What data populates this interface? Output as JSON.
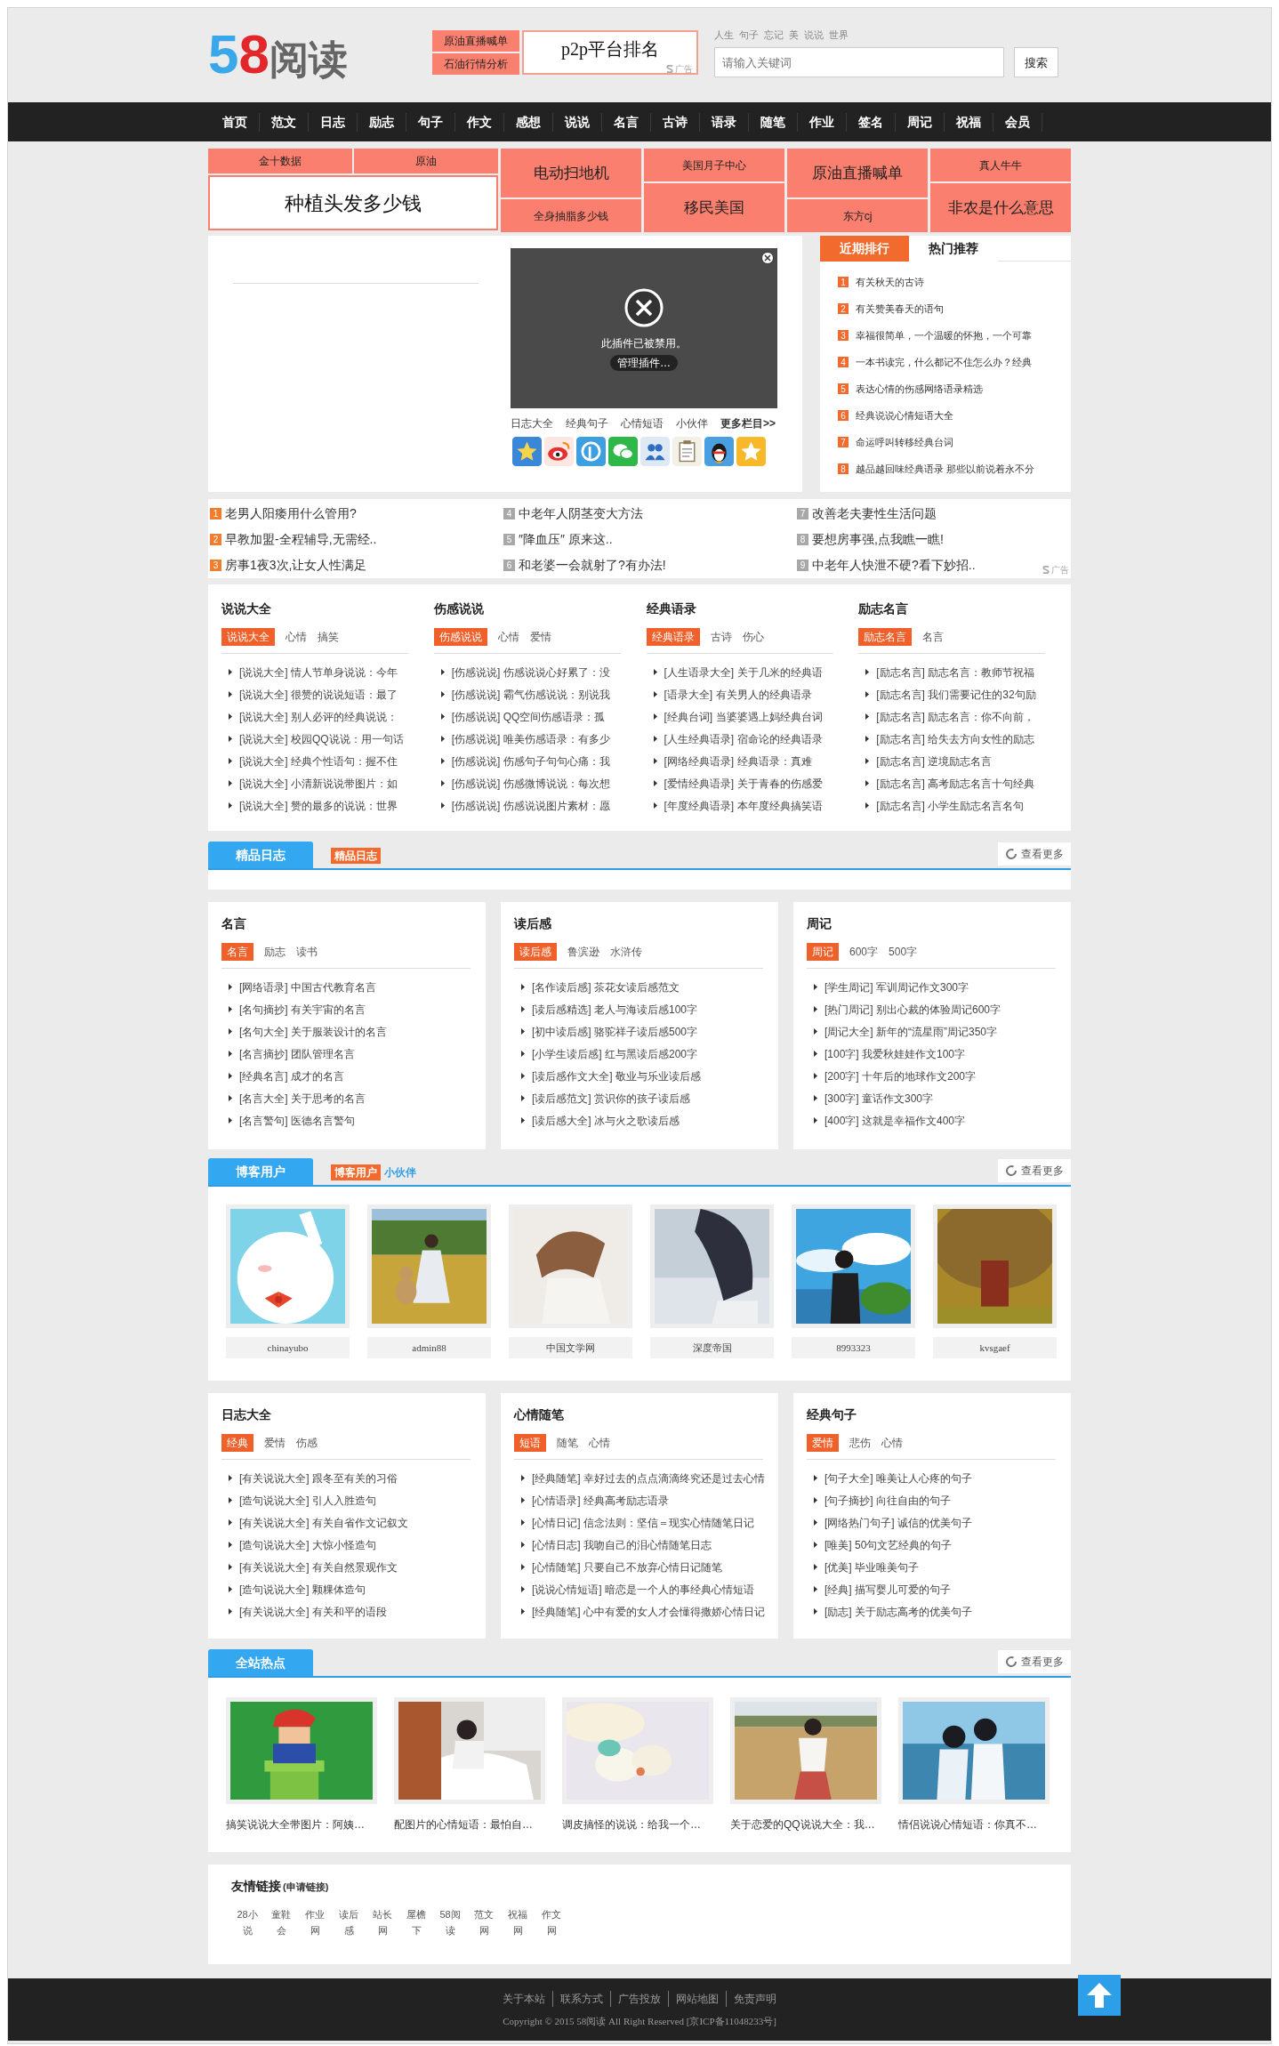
{
  "header": {
    "logo_digits": "58",
    "logo_name": "阅读",
    "ad_links": [
      "原油直播喊单",
      "石油行情分析"
    ],
    "ad_main": "p2p平台排名",
    "ad_mark": "广告",
    "hot_words": [
      "人生",
      "句子",
      "忘记",
      "美",
      "说说",
      "世界"
    ],
    "search": {
      "placeholder": "请输入关键词",
      "button": "搜索"
    }
  },
  "nav": [
    "首页",
    "范文",
    "日志",
    "励志",
    "句子",
    "作文",
    "感想",
    "说说",
    "名言",
    "古诗",
    "语录",
    "随笔",
    "作业",
    "签名",
    "周记",
    "祝福",
    "会员"
  ],
  "ad_grid": {
    "top": [
      "金十数据",
      "原油"
    ],
    "main": "种植头发多少钱",
    "columns": [
      {
        "cells": [
          {
            "text": "电动扫地机",
            "kind": "large"
          },
          {
            "text": "全身抽脂多少钱",
            "kind": "small"
          }
        ]
      },
      {
        "cells": [
          {
            "text": "美国月子中心",
            "kind": "small"
          },
          {
            "text": "移民美国",
            "kind": "large"
          }
        ]
      },
      {
        "cells": [
          {
            "text": "原油直播喊单",
            "kind": "large"
          },
          {
            "text": "东方cj",
            "kind": "small"
          }
        ]
      },
      {
        "cells": [
          {
            "text": "真人牛牛",
            "kind": "small"
          },
          {
            "text": "非农是什么意思",
            "kind": "large"
          }
        ]
      }
    ]
  },
  "plugin": {
    "message": "此插件已被禁用。",
    "button": "管理插件…"
  },
  "quick_links": [
    "日志大全",
    "经典句子",
    "心情短语",
    "小伙伴"
  ],
  "more_columns": "更多栏目>>",
  "ranking": {
    "tabs": [
      {
        "label": "近期排行",
        "selected": true
      },
      {
        "label": "热门推荐",
        "selected": false
      }
    ],
    "items": [
      {
        "num": "1",
        "text": "有关秋天的古诗"
      },
      {
        "num": "2",
        "text": "有关赞美春天的语句"
      },
      {
        "num": "3",
        "text": "幸福很简单，一个温暖的怀抱，一个可靠"
      },
      {
        "num": "4",
        "text": "一本书读完，什么都记不住怎么办？经典"
      },
      {
        "num": "5",
        "text": "表达心情的伤感网络语录精选"
      },
      {
        "num": "6",
        "text": "经典说说心情短语大全"
      },
      {
        "num": "7",
        "text": "命运呼叫转移经典台词"
      },
      {
        "num": "8",
        "text": "越品越回味经典语录 那些以前说着永不分"
      }
    ]
  },
  "text_ads": {
    "mark": "广告",
    "items": [
      {
        "num": "1",
        "text": "老男人阳痿用什么管用?",
        "hot": true
      },
      {
        "num": "2",
        "text": "早教加盟-全程辅导,无需经..",
        "hot": true
      },
      {
        "num": "3",
        "text": "房事1夜3次,让女人性满足",
        "hot": true
      },
      {
        "num": "4",
        "text": "中老年人阴茎变大方法",
        "hot": false
      },
      {
        "num": "5",
        "text": "″降血压″ 原来这..",
        "hot": false
      },
      {
        "num": "6",
        "text": "和老婆一会就射了?有办法!",
        "hot": false
      },
      {
        "num": "7",
        "text": "改善老夫妻性生活问题",
        "hot": false
      },
      {
        "num": "8",
        "text": "要想房事强,点我瞧一瞧!",
        "hot": false
      },
      {
        "num": "9",
        "text": "中老年人快泄不硬?看下妙招..",
        "hot": false
      }
    ]
  },
  "categories_1": [
    {
      "title": "说说大全",
      "tags": [
        {
          "label": "说说大全",
          "selected": true
        },
        {
          "label": "心情",
          "selected": false
        },
        {
          "label": "搞笑",
          "selected": false
        }
      ],
      "items": [
        "[说说大全] 情人节单身说说：今年",
        "[说说大全] 很赞的说说短语：最了",
        "[说说大全] 别人必评的经典说说：",
        "[说说大全] 校园QQ说说：用一句话",
        "[说说大全] 经典个性语句：握不住",
        "[说说大全] 小清新说说带图片：如",
        "[说说大全] 赞的最多的说说：世界"
      ]
    },
    {
      "title": "伤感说说",
      "tags": [
        {
          "label": "伤感说说",
          "selected": true
        },
        {
          "label": "心情",
          "selected": false
        },
        {
          "label": "爱情",
          "selected": false
        }
      ],
      "items": [
        "[伤感说说] 伤感说说心好累了：没",
        "[伤感说说] 霸气伤感说说：别说我",
        "[伤感说说] QQ空间伤感语录：孤",
        "[伤感说说] 唯美伤感语录：有多少",
        "[伤感说说] 伤感句子句句心痛：我",
        "[伤感说说] 伤感微博说说：每次想",
        "[伤感说说] 伤感说说图片素材：愿"
      ]
    },
    {
      "title": "经典语录",
      "tags": [
        {
          "label": "经典语录",
          "selected": true
        },
        {
          "label": "古诗",
          "selected": false
        },
        {
          "label": "伤心",
          "selected": false
        }
      ],
      "items": [
        "[人生语录大全] 关于几米的经典语",
        "[语录大全] 有关男人的经典语录",
        "[经典台词] 当婆婆遇上妈经典台词",
        "[人生经典语录] 宿命论的经典语录",
        "[网络经典语录] 经典语录：真难",
        "[爱情经典语录] 关于青春的伤感爱",
        "[年度经典语录] 本年度经典搞笑语"
      ]
    },
    {
      "title": "励志名言",
      "tags": [
        {
          "label": "励志名言",
          "selected": true
        },
        {
          "label": "名言",
          "selected": false
        }
      ],
      "items": [
        "[励志名言] 励志名言：教师节祝福",
        "[励志名言] 我们需要记住的32句励",
        "[励志名言] 励志名言：你不向前，",
        "[励志名言] 给失去方向女性的励志",
        "[励志名言] 逆境励志名言",
        "[励志名言] 高考励志名言十句经典",
        "[励志名言] 小学生励志名言名句"
      ]
    }
  ],
  "section_diary": {
    "tab": "精品日志",
    "badge": "精品日志",
    "more": "查看更多"
  },
  "categories_2": [
    {
      "title": "名言",
      "tags": [
        {
          "label": "名言",
          "selected": true
        },
        {
          "label": "励志",
          "selected": false
        },
        {
          "label": "读书",
          "selected": false
        }
      ],
      "items": [
        "[网络语录] 中国古代教育名言",
        "[名句摘抄] 有关宇宙的名言",
        "[名句大全] 关于服装设计的名言",
        "[名言摘抄] 团队管理名言",
        "[经典名言] 成才的名言",
        "[名言大全] 关于思考的名言",
        "[名言警句] 医德名言警句"
      ]
    },
    {
      "title": "读后感",
      "tags": [
        {
          "label": "读后感",
          "selected": true
        },
        {
          "label": "鲁滨逊",
          "selected": false
        },
        {
          "label": "水浒传",
          "selected": false
        }
      ],
      "items": [
        "[名作读后感] 茶花女读后感范文",
        "[读后感精选] 老人与海读后感100字",
        "[初中读后感] 骆驼祥子读后感500字",
        "[小学生读后感] 红与黑读后感200字",
        "[读后感作文大全] 敬业与乐业读后感",
        "[读后感范文] 赏识你的孩子读后感",
        "[读后感大全] 冰与火之歌读后感"
      ]
    },
    {
      "title": "周记",
      "tags": [
        {
          "label": "周记",
          "selected": true
        },
        {
          "label": "600字",
          "selected": false
        },
        {
          "label": "500字",
          "selected": false
        }
      ],
      "items": [
        "[学生周记] 军训周记作文300字",
        "[热门周记] 别出心裁的体验周记600字",
        "[周记大全] 新年的“流星雨”周记350字",
        "[100字] 我爱秋娃娃作文100字",
        "[200字] 十年后的地球作文200字",
        "[300字] 童话作文300字",
        "[400字] 这就是幸福作文400字"
      ]
    }
  ],
  "section_blog": {
    "tab": "博客用户",
    "badge": "博客用户",
    "link": "小伙伴",
    "more": "查看更多"
  },
  "users": [
    {
      "name": "chinayubo"
    },
    {
      "name": "admin88"
    },
    {
      "name": "中国文学网"
    },
    {
      "name": "深度帝国"
    },
    {
      "name": "8993323"
    },
    {
      "name": "kvsgaef"
    }
  ],
  "categories_3": [
    {
      "title": "日志大全",
      "tags": [
        {
          "label": "经典",
          "selected": true
        },
        {
          "label": "爱情",
          "selected": false
        },
        {
          "label": "伤感",
          "selected": false
        }
      ],
      "items": [
        "[有关说说大全] 跟冬至有关的习俗",
        "[造句说说大全] 引人入胜造句",
        "[有关说说大全] 有关自省作文记叙文",
        "[造句说说大全] 大惊小怪造句",
        "[有关说说大全] 有关自然景观作文",
        "[造句说说大全] 颗粿体造句",
        "[有关说说大全] 有关和平的语段"
      ]
    },
    {
      "title": "心情随笔",
      "tags": [
        {
          "label": "短语",
          "selected": true
        },
        {
          "label": "随笔",
          "selected": false
        },
        {
          "label": "心情",
          "selected": false
        }
      ],
      "items": [
        "[经典随笔] 幸好过去的点点滴滴终究还是过去心情",
        "[心情语录] 经典高考励志语录",
        "[心情日记] 信念法则：坚信＝现实心情随笔日记",
        "[心情日志] 我吻自己的泪心情随笔日志",
        "[心情随笔] 只要自己不放弃心情日记随笔",
        "[说说心情短语] 暗恋是一个人的事经典心情短语",
        "[经典随笔] 心中有爱的女人才会懂得撒娇心情日记"
      ]
    },
    {
      "title": "经典句子",
      "tags": [
        {
          "label": "爱情",
          "selected": true
        },
        {
          "label": "悲伤",
          "selected": false
        },
        {
          "label": "心情",
          "selected": false
        }
      ],
      "items": [
        "[句子大全] 唯美让人心疼的句子",
        "[句子摘抄] 向往自由的句子",
        "[网络热门句子] 诚信的优美句子",
        "[唯美] 50句文艺经典的句子",
        "[优美] 毕业唯美句子",
        "[经典] 描写婴儿可爱的句子",
        "[励志] 关于励志高考的优美句子"
      ]
    }
  ],
  "section_hot": {
    "tab": "全站热点",
    "more": "查看更多",
    "items": [
      {
        "caption": "搞笑说说大全带图片：阿姨…"
      },
      {
        "caption": "配图片的心情短语：最怕自…"
      },
      {
        "caption": "调皮搞怪的说说：给我一个…"
      },
      {
        "caption": "关于恋爱的QQ说说大全：我…"
      },
      {
        "caption": "情侣说说心情短语：你真不…"
      }
    ]
  },
  "friend_links": {
    "title": "友情链接",
    "apply": "(申请链接)",
    "items": [
      "28小说",
      "童鞋会",
      "作业网",
      "读后感",
      "站长网",
      "屋檐下",
      "58阅读",
      "范文网",
      "祝福网",
      "作文网"
    ]
  },
  "footer": {
    "links": [
      "关于本站",
      "联系方式",
      "广告投放",
      "网站地图",
      "免责声明"
    ],
    "copyright": "Copyright © 2015 58阅读 All Right Reserved [京ICP备11048233号]"
  }
}
